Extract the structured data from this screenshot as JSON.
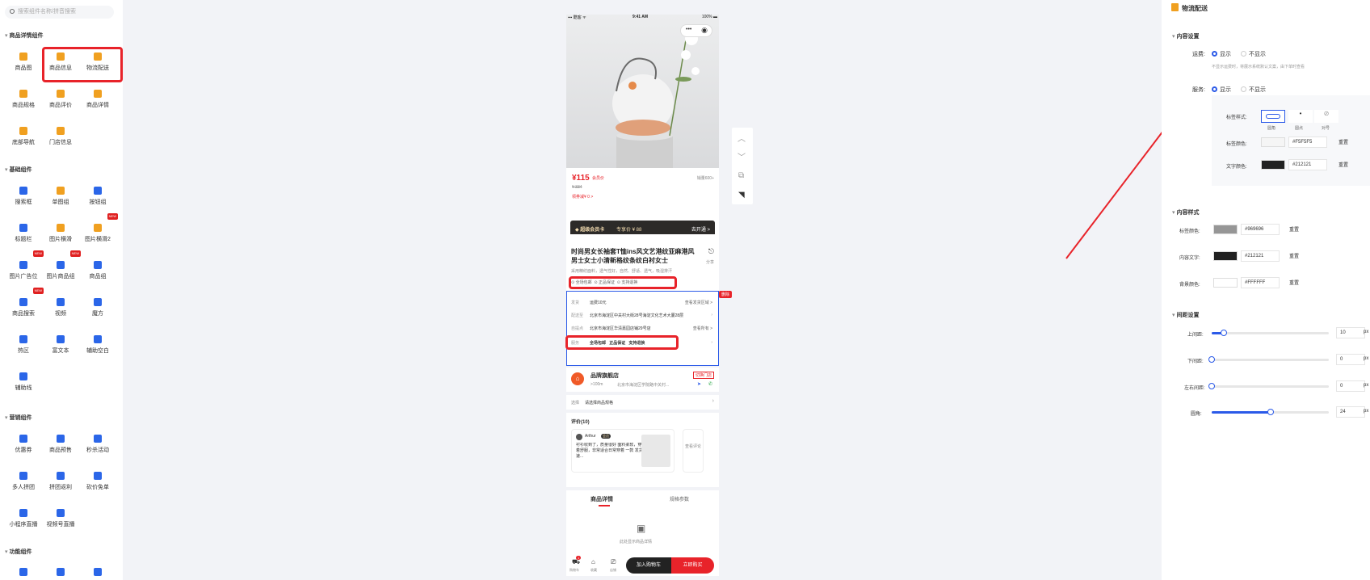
{
  "search": {
    "placeholder": "搜索组件名称/拼音搜索"
  },
  "sections": {
    "detail": "商品详情组件",
    "basic": "基础组件",
    "marketing": "营销组件",
    "function": "功能组件"
  },
  "items": {
    "detail": [
      {
        "label": "商品图",
        "icon": "image-icon"
      },
      {
        "label": "商品信息",
        "icon": "info-icon"
      },
      {
        "label": "物流配送",
        "icon": "bookmark-icon"
      },
      {
        "label": "商品规格",
        "icon": "list-icon"
      },
      {
        "label": "商品评价",
        "icon": "comment-icon"
      },
      {
        "label": "商品详情",
        "icon": "doc-icon"
      },
      {
        "label": "底部导航",
        "icon": "cart-icon"
      },
      {
        "label": "门店信息",
        "icon": "store-icon"
      }
    ],
    "basic": [
      {
        "label": "搜索框",
        "icon": "search-icon"
      },
      {
        "label": "单图组",
        "icon": "image-icon"
      },
      {
        "label": "按钮组",
        "icon": "pin-icon"
      },
      {
        "label": "标题栏",
        "icon": "title-icon"
      },
      {
        "label": "图片横滑",
        "icon": "image-icon"
      },
      {
        "label": "图片横滑2",
        "icon": "image-icon",
        "badge": "NEW"
      },
      {
        "label": "图片广告位",
        "icon": "grid-icon",
        "badge": "NEW"
      },
      {
        "label": "图片商品组",
        "icon": "grid-icon",
        "badge": "NEW"
      },
      {
        "label": "商品组",
        "icon": "box-icon"
      },
      {
        "label": "商品搜索",
        "icon": "calendar-icon",
        "badge": "NEW"
      },
      {
        "label": "视频",
        "icon": "video-icon"
      },
      {
        "label": "魔方",
        "icon": "cube-icon"
      },
      {
        "label": "热区",
        "icon": "hotspot-icon"
      },
      {
        "label": "富文本",
        "icon": "text-icon"
      },
      {
        "label": "辅助空白",
        "icon": "blank-icon"
      },
      {
        "label": "辅助线",
        "icon": "line-icon"
      }
    ],
    "marketing": [
      {
        "label": "优惠券",
        "icon": "coupon-icon"
      },
      {
        "label": "商品预售",
        "icon": "presale-icon"
      },
      {
        "label": "秒杀活动",
        "icon": "seckill-icon"
      },
      {
        "label": "多人拼团",
        "icon": "group-icon"
      },
      {
        "label": "拼团返利",
        "icon": "group-icon"
      },
      {
        "label": "砍价免单",
        "icon": "bargain-icon"
      },
      {
        "label": "小程序直播",
        "icon": "live-icon"
      },
      {
        "label": "视频号直播",
        "icon": "live-icon"
      }
    ],
    "function": [
      {
        "label": "",
        "icon": "widget-icon"
      },
      {
        "label": "",
        "icon": "user-add-icon"
      },
      {
        "label": "",
        "icon": "mail-icon"
      }
    ]
  },
  "phone": {
    "carrier": "▪▪▪ 酷客 ᯤ",
    "time": "9:41 AM",
    "battery": "100% ▬",
    "price": "¥115",
    "price_tag": "会员价",
    "orig_price": "¥ 334",
    "sales": "销量600+",
    "coupon_link": "领券减¥ 0 >",
    "vip_label": "◆ 超级会员卡",
    "vip_save": "专享价 ¥ 88",
    "vip_open": "去开通 >",
    "title": "时尚男女长袖套T恤ins风文艺港纹亚麻港风男士女士小清新格纹条纹白衬女士",
    "share": "分享",
    "subtitle": "采用精纺面料，透气性好，自然、舒适、透气，吸湿排汗",
    "tags": [
      "⊙ 全场包邮",
      "⊙ 正品保证",
      "⊙ 支持退换"
    ],
    "ship_label": "发货",
    "ship_val": "运费10元",
    "ship_right": "查看发货区域 >",
    "area_label": "配送至",
    "area_val": "北京市海淀区中关村大街28号海淀文化艺术大厦28层",
    "pickup_label": "自提点",
    "pickup_val": "北京市海淀区华清嘉园店铺29号店",
    "pickup_right": "查看所有 >",
    "service_label": "服务",
    "services": [
      "全场包邮",
      "正品保证",
      "支持退换"
    ],
    "delete_badge": "删除",
    "store_name": "品牌旗舰店",
    "store_switch": "切换门店",
    "store_dist": ">100m",
    "store_addr": "北京市海淀区学院路中关村...",
    "spec_label": "选择",
    "spec_val": "请选择商品规格",
    "review_title": "评价(10)",
    "reviewer": "Arthur",
    "reviewer_tag": "会员",
    "review_text": "衬衫收到了，质量很好 面料柔软，穿着舒服，非常适合日常穿着 一款 发货速...",
    "review_more": "查看评论",
    "tab_detail": "商品详情",
    "tab_params": "规格参数",
    "empty_detail": "此处显示商品详情",
    "nav_cart": "购物车",
    "nav_cart_count": "1",
    "nav_fav": "收藏",
    "nav_store": "店铺",
    "add_cart": "加入购物车",
    "buy_now": "立即购买"
  },
  "panel": {
    "title": "物流配送",
    "content_settings": "内容设置",
    "freight_label": "运费:",
    "show": "显示",
    "hide": "不显示",
    "freight_note": "不显示运费时，将展示系统默认文案，由下单时查看",
    "service_label": "服务:",
    "tag_style_label": "标签样式:",
    "styles": [
      "圆角",
      "圆点",
      "对号"
    ],
    "tag_color_label": "标签颜色:",
    "tag_color": "#F5F5F5",
    "text_color_label": "文字颜色:",
    "text_color": "#212121",
    "reset": "重置",
    "content_style": "内容样式",
    "label_color_label": "标签颜色:",
    "label_color": "#969696",
    "content_text_label": "内容文字:",
    "content_text": "#212121",
    "bg_color_label": "背景颜色:",
    "bg_color": "#FFFFFF",
    "spacing": "间距设置",
    "top_label": "上间距:",
    "top": "10",
    "bottom_label": "下间距:",
    "bottom": "0",
    "lr_label": "左右间距:",
    "lr": "0",
    "radius_label": "圆角:",
    "radius": "24",
    "unit": "px",
    "top_frac": 0.1,
    "bottom_frac": 0,
    "lr_frac": 0,
    "radius_frac": 0.5
  },
  "colors": {
    "accent": "#2b5ae8",
    "red": "#e8232a",
    "orange": "#f0a020",
    "dark": "#222222"
  }
}
